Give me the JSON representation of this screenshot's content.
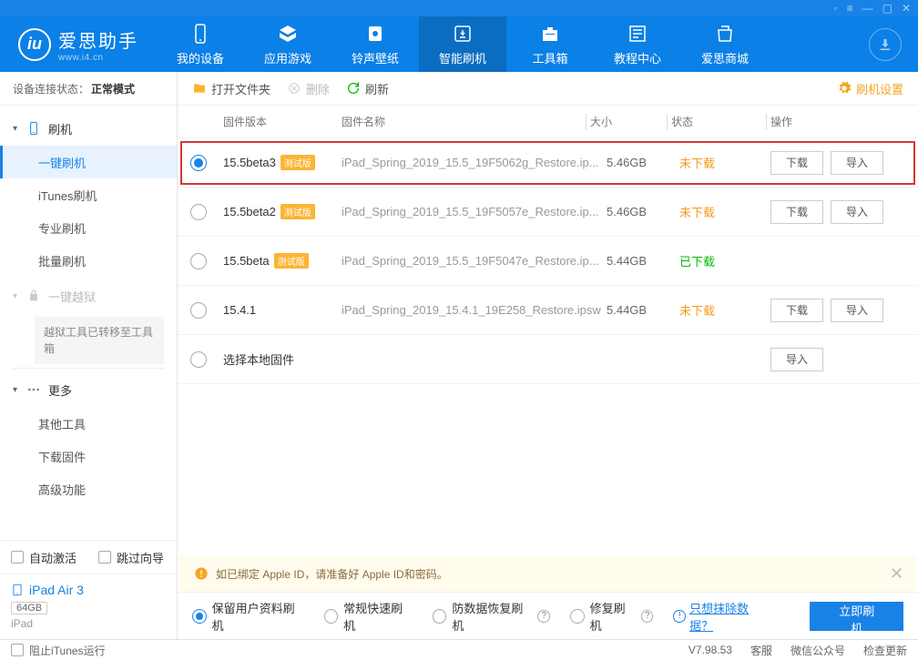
{
  "winbar": [
    "◦",
    "≡",
    "—",
    "▢",
    "✕"
  ],
  "logo": {
    "brand": "爱思助手",
    "site": "www.i4.cn"
  },
  "nav": [
    {
      "label": "我的设备"
    },
    {
      "label": "应用游戏"
    },
    {
      "label": "铃声壁纸"
    },
    {
      "label": "智能刷机",
      "active": true
    },
    {
      "label": "工具箱"
    },
    {
      "label": "教程中心"
    },
    {
      "label": "爱思商城"
    }
  ],
  "sidebar": {
    "conn_label": "设备连接状态：",
    "conn_value": "正常模式",
    "groups": {
      "flash": {
        "title": "刷机",
        "items": [
          {
            "label": "一键刷机",
            "active": true
          },
          {
            "label": "iTunes刷机"
          },
          {
            "label": "专业刷机"
          },
          {
            "label": "批量刷机"
          }
        ]
      },
      "jailbreak": {
        "title": "一键越狱",
        "note": "越狱工具已转移至工具箱"
      },
      "more": {
        "title": "更多",
        "items": [
          {
            "label": "其他工具"
          },
          {
            "label": "下载固件"
          },
          {
            "label": "高级功能"
          }
        ]
      }
    },
    "auto_activate": "自动激活",
    "skip_guide": "跳过向导",
    "device": {
      "name": "iPad Air 3",
      "capacity": "64GB",
      "type": "iPad"
    }
  },
  "toolbar": {
    "open": "打开文件夹",
    "delete": "删除",
    "refresh": "刷新",
    "settings": "刷机设置"
  },
  "table": {
    "headers": {
      "version": "固件版本",
      "name": "固件名称",
      "size": "大小",
      "status": "状态",
      "action": "操作"
    },
    "btn_download": "下载",
    "btn_import": "导入",
    "local_label": "选择本地固件",
    "rows": [
      {
        "version": "15.5beta3",
        "beta": "测试版",
        "name": "iPad_Spring_2019_15.5_19F5062g_Restore.ip...",
        "size": "5.46GB",
        "status": "未下载",
        "status_class": "pending",
        "selected": true,
        "highlight": true,
        "dl": true
      },
      {
        "version": "15.5beta2",
        "beta": "测试版",
        "name": "iPad_Spring_2019_15.5_19F5057e_Restore.ip...",
        "size": "5.46GB",
        "status": "未下载",
        "status_class": "pending",
        "dl": true
      },
      {
        "version": "15.5beta",
        "beta": "测试版",
        "name": "iPad_Spring_2019_15.5_19F5047e_Restore.ip...",
        "size": "5.44GB",
        "status": "已下载",
        "status_class": "done",
        "dl": false
      },
      {
        "version": "15.4.1",
        "beta": null,
        "name": "iPad_Spring_2019_15.4.1_19E258_Restore.ipsw",
        "size": "5.44GB",
        "status": "未下载",
        "status_class": "pending",
        "dl": true
      }
    ]
  },
  "warn": "如已绑定 Apple ID，请准备好 Apple ID和密码。",
  "modes": [
    {
      "label": "保留用户资料刷机",
      "selected": true
    },
    {
      "label": "常规快速刷机"
    },
    {
      "label": "防数据恢复刷机",
      "help": true
    },
    {
      "label": "修复刷机",
      "help": true
    }
  ],
  "erase_link": "只想抹除数据？",
  "flash_btn": "立即刷机",
  "footer": {
    "block_itunes": "阻止iTunes运行",
    "version": "V7.98.53",
    "service": "客服",
    "wechat": "微信公众号",
    "update": "检查更新"
  }
}
